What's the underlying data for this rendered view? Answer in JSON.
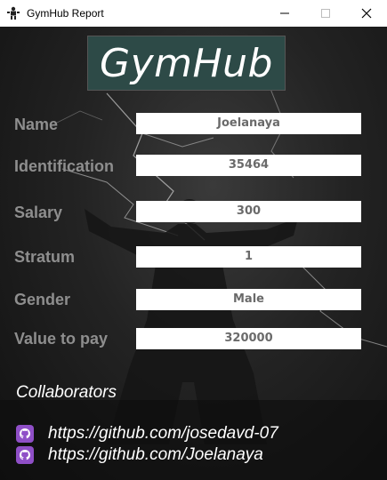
{
  "window": {
    "title": "GymHub Report",
    "app_icon": "gym-person-icon",
    "controls": [
      "minimize-icon",
      "maximize-icon",
      "close-icon"
    ]
  },
  "logo": {
    "text": "GymHub",
    "background": "#2d4a47"
  },
  "fields": [
    {
      "label": "Name",
      "value": "Joelanaya"
    },
    {
      "label": "Identification",
      "value": "35464"
    },
    {
      "label": "Salary",
      "value": "300"
    },
    {
      "label": "Stratum",
      "value": "1"
    },
    {
      "label": "Gender",
      "value": "Male"
    },
    {
      "label": "Value to pay",
      "value": "320000"
    }
  ],
  "collaborators": {
    "heading": "Collaborators",
    "links": [
      {
        "icon": "github-icon",
        "text": "https://github.com/josedavd-07"
      },
      {
        "icon": "github-icon",
        "text": "https://github.com/Joelanaya"
      }
    ]
  },
  "colors": {
    "label": "#8e8e8e",
    "value_text": "#6a6a6a",
    "accent_icon": "#8f4fc7"
  }
}
